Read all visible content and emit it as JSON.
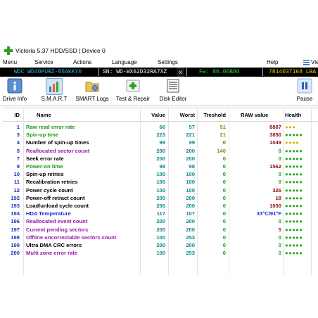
{
  "window": {
    "title": "Victoria 5.37 HDD/SSD | Device 0"
  },
  "menu": [
    "Menu",
    "Service",
    "Actions",
    "Language",
    "Settings",
    "Help",
    "Vie"
  ],
  "device_bar": {
    "model": "WDC WD40PURZ-85AKKY0",
    "serial": "SN: WD-WX62D32RA7XZ",
    "close": "x",
    "firmware": "Fw: 80.00B80",
    "lba": "7814037168 LBA (4"
  },
  "toolbar": [
    {
      "label": "Drive Info",
      "icon": "drive-info-icon"
    },
    {
      "label": "S.M.A.R.T",
      "icon": "smart-chart-icon",
      "active": true
    },
    {
      "label": "SMART Logs",
      "icon": "smart-logs-icon"
    },
    {
      "label": "Test & Repair",
      "icon": "test-repair-icon"
    },
    {
      "label": "Disk Editor",
      "icon": "disk-editor-icon"
    },
    {
      "label": "Pause",
      "icon": "pause-icon"
    }
  ],
  "columns": [
    "ID",
    "Name",
    "Value",
    "Worst",
    "Treshold",
    "RAW value",
    "Health"
  ],
  "colors": {
    "green": "#1a9a1a",
    "black": "#000000",
    "purple": "#9a1aa8",
    "blue": "#1a2ad8",
    "id": "#2233bb",
    "teal": "#0a8a8a",
    "olive": "#8a8a1a",
    "raw_red": "#c8102e",
    "raw_dark": "#8a1010",
    "raw_green": "#1a9a1a",
    "health_green": "#1aaa1a",
    "health_yellow": "#e0b000"
  },
  "rows": [
    {
      "id": "1",
      "name": "Raw read error rate",
      "nc": "green",
      "value": "66",
      "worst": "57",
      "tresh": "51",
      "tc": "olive",
      "raw": "8887",
      "rc": "raw_dark",
      "health": "●●●",
      "hc": "health_yellow"
    },
    {
      "id": "3",
      "name": "Spin-up time",
      "nc": "green",
      "value": "223",
      "worst": "221",
      "tresh": "21",
      "tc": "olive",
      "raw": "3850",
      "rc": "raw_dark",
      "health": "●●●●●",
      "hc": "health_green"
    },
    {
      "id": "4",
      "name": "Number of spin-up times",
      "nc": "black",
      "value": "99",
      "worst": "99",
      "tresh": "0",
      "tc": "raw_green",
      "raw": "1049",
      "rc": "raw_dark",
      "health": "●●●●",
      "hc": "health_yellow"
    },
    {
      "id": "5",
      "name": "Reallocated sector count",
      "nc": "purple",
      "value": "200",
      "worst": "200",
      "tresh": "140",
      "tc": "olive",
      "raw": "0",
      "rc": "raw_green",
      "health": "●●●●●",
      "hc": "health_green"
    },
    {
      "id": "7",
      "name": "Seek error rate",
      "nc": "black",
      "value": "200",
      "worst": "200",
      "tresh": "0",
      "tc": "raw_green",
      "raw": "0",
      "rc": "raw_green",
      "health": "●●●●●",
      "hc": "health_green"
    },
    {
      "id": "9",
      "name": "Power-on time",
      "nc": "green",
      "value": "98",
      "worst": "98",
      "tresh": "0",
      "tc": "raw_green",
      "raw": "1562",
      "rc": "raw_dark",
      "health": "●●●●●",
      "hc": "health_green"
    },
    {
      "id": "10",
      "name": "Spin-up retries",
      "nc": "black",
      "value": "100",
      "worst": "100",
      "tresh": "0",
      "tc": "raw_green",
      "raw": "0",
      "rc": "raw_green",
      "health": "●●●●●",
      "hc": "health_green"
    },
    {
      "id": "11",
      "name": "Recalibration retries",
      "nc": "black",
      "value": "100",
      "worst": "100",
      "tresh": "0",
      "tc": "raw_green",
      "raw": "0",
      "rc": "raw_green",
      "health": "●●●●●",
      "hc": "health_green"
    },
    {
      "id": "12",
      "name": "Power cycle count",
      "nc": "black",
      "value": "100",
      "worst": "100",
      "tresh": "0",
      "tc": "raw_green",
      "raw": "326",
      "rc": "raw_dark",
      "health": "●●●●●",
      "hc": "health_green"
    },
    {
      "id": "192",
      "name": "Power-off retract count",
      "nc": "black",
      "value": "200",
      "worst": "200",
      "tresh": "0",
      "tc": "raw_green",
      "raw": "18",
      "rc": "raw_dark",
      "health": "●●●●●",
      "hc": "health_green"
    },
    {
      "id": "193",
      "name": "Load/unload cycle count",
      "nc": "black",
      "value": "200",
      "worst": "200",
      "tresh": "0",
      "tc": "raw_green",
      "raw": "1030",
      "rc": "raw_dark",
      "health": "●●●●●",
      "hc": "health_green"
    },
    {
      "id": "194",
      "name": "HDA Temperature",
      "nc": "blue",
      "value": "117",
      "worst": "107",
      "tresh": "0",
      "tc": "raw_green",
      "raw": "33°C/91°F",
      "rc": "blue",
      "health": "●●●●●",
      "hc": "health_green"
    },
    {
      "id": "196",
      "name": "Reallocated event count",
      "nc": "purple",
      "value": "200",
      "worst": "200",
      "tresh": "0",
      "tc": "raw_green",
      "raw": "0",
      "rc": "raw_green",
      "health": "●●●●●",
      "hc": "health_green"
    },
    {
      "id": "197",
      "name": "Current pending sectors",
      "nc": "purple",
      "value": "200",
      "worst": "200",
      "tresh": "0",
      "tc": "raw_green",
      "raw": "5",
      "rc": "raw_red",
      "health": "●●●●●",
      "hc": "health_green"
    },
    {
      "id": "198",
      "name": "Offline uncorrectable sectors count",
      "nc": "purple",
      "value": "100",
      "worst": "253",
      "tresh": "0",
      "tc": "raw_green",
      "raw": "0",
      "rc": "raw_green",
      "health": "●●●●●",
      "hc": "health_green"
    },
    {
      "id": "199",
      "name": "Ultra DMA CRC errors",
      "nc": "black",
      "value": "200",
      "worst": "200",
      "tresh": "0",
      "tc": "raw_green",
      "raw": "0",
      "rc": "raw_green",
      "health": "●●●●●",
      "hc": "health_green"
    },
    {
      "id": "200",
      "name": "Multi zone error rate",
      "nc": "purple",
      "value": "100",
      "worst": "253",
      "tresh": "0",
      "tc": "raw_green",
      "raw": "0",
      "rc": "raw_green",
      "health": "●●●●●",
      "hc": "health_green"
    }
  ]
}
